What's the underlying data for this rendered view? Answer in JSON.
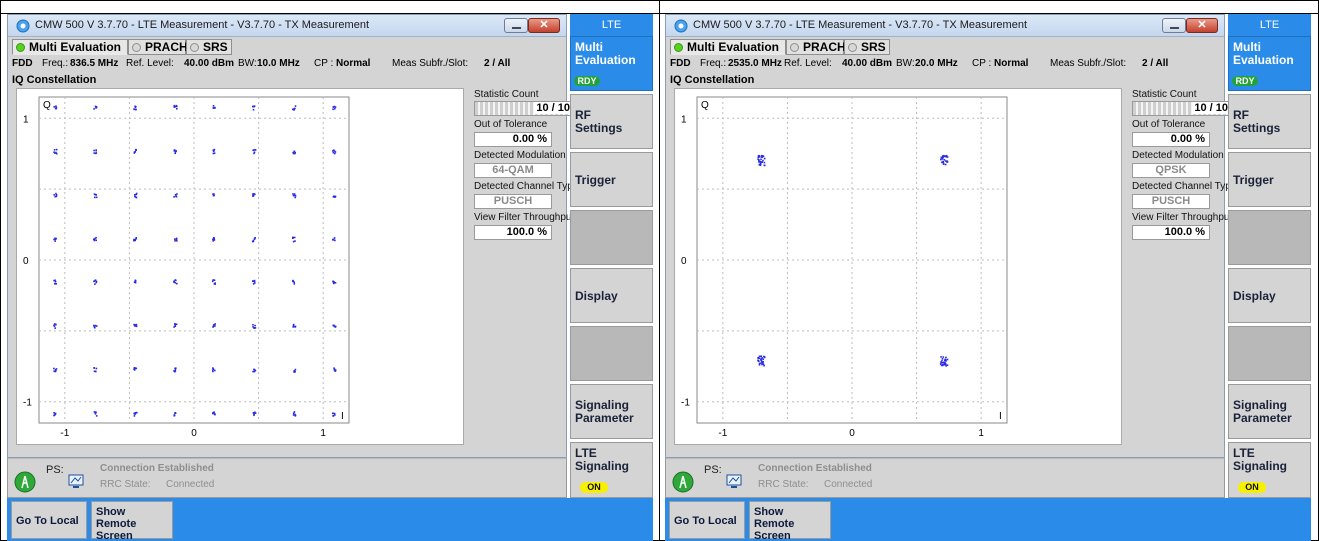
{
  "colors": {
    "accent_blue": "#2a8ce8",
    "panel_grey": "#d4d4d4",
    "ready_green": "#22a33a",
    "on_yellow": "#f7f000",
    "iq_point_blue": "#2a2ae6"
  },
  "panels": [
    {
      "window_title": "CMW 500 V 3.7.70 - LTE Measurement  - V3.7.70 - TX Measurement",
      "tabs": [
        "Multi Evaluation",
        "PRACH",
        "SRS"
      ],
      "info": {
        "mode": "FDD",
        "freq_label": "Freq.:",
        "freq_value": "836.5 MHz",
        "ref_label": "Ref. Level:",
        "ref_value": "40.00 dBm",
        "bw_label": "BW:",
        "bw_value": "10.0 MHz",
        "cp_label": "CP :",
        "cp_value": "Normal",
        "subfr_label": "Meas Subfr./Slot:",
        "subfr_value": "2  / All"
      },
      "section_title": "IQ Constellation",
      "stats": {
        "statistic_count_label": "Statistic Count",
        "statistic_count_value": "10 / 10",
        "out_of_tolerance_label": "Out of Tolerance",
        "out_of_tolerance_value": "0.00  %",
        "detected_modulation_label": "Detected Modulation",
        "detected_modulation_value": "64-QAM",
        "detected_channel_label": "Detected Channel Type",
        "detected_channel_value": "PUSCH",
        "filter_throughput_label": "View Filter Throughput",
        "filter_throughput_value": "100.0  %"
      },
      "status": {
        "ps_label": "PS:",
        "connection_text": "Connection Established",
        "rrc_label": "RRC State:",
        "rrc_value": "Connected"
      },
      "bottom_buttons": {
        "local": "Go To Local",
        "remote": "Show Remote Screen"
      },
      "sidebar": {
        "header": "LTE",
        "multi_evaluation": "Multi Evaluation",
        "rdy_badge": "RDY",
        "rf_settings": "RF Settings",
        "trigger": "Trigger",
        "display": "Display",
        "signaling_parameter": "Signaling Parameter",
        "lte_signaling": "LTE Signaling",
        "on_badge": "ON"
      }
    },
    {
      "window_title": "CMW 500 V 3.7.70 - LTE Measurement  - V3.7.70 - TX Measurement",
      "tabs": [
        "Multi Evaluation",
        "PRACH",
        "SRS"
      ],
      "info": {
        "mode": "FDD",
        "freq_label": "Freq.:",
        "freq_value": "2535.0 MHz",
        "ref_label": "Ref. Level:",
        "ref_value": "40.00 dBm",
        "bw_label": "BW:",
        "bw_value": "20.0 MHz",
        "cp_label": "CP :",
        "cp_value": "Normal",
        "subfr_label": "Meas Subfr./Slot:",
        "subfr_value": "2  / All"
      },
      "section_title": "IQ Constellation",
      "stats": {
        "statistic_count_label": "Statistic Count",
        "statistic_count_value": "10 / 10",
        "out_of_tolerance_label": "Out of Tolerance",
        "out_of_tolerance_value": "0.00  %",
        "detected_modulation_label": "Detected Modulation",
        "detected_modulation_value": "QPSK",
        "detected_channel_label": "Detected Channel Type",
        "detected_channel_value": "PUSCH",
        "filter_throughput_label": "View Filter Throughput",
        "filter_throughput_value": "100.0  %"
      },
      "status": {
        "ps_label": "PS:",
        "connection_text": "Connection Established",
        "rrc_label": "RRC State:",
        "rrc_value": "Connected"
      },
      "bottom_buttons": {
        "local": "Go To Local",
        "remote": "Show Remote Screen"
      },
      "sidebar": {
        "header": "LTE",
        "multi_evaluation": "Multi Evaluation",
        "rdy_badge": "RDY",
        "rf_settings": "RF Settings",
        "trigger": "Trigger",
        "display": "Display",
        "signaling_parameter": "Signaling Parameter",
        "lte_signaling": "LTE Signaling",
        "on_badge": "ON"
      }
    }
  ],
  "chart_data": [
    {
      "type": "scatter",
      "title": "IQ Constellation",
      "xlabel": "I",
      "ylabel": "Q",
      "xlim": [
        -1.2,
        1.2
      ],
      "ylim": [
        -1.15,
        1.15
      ],
      "x_ticks": [
        "-1",
        "0",
        "1"
      ],
      "y_ticks": [
        "1",
        "0",
        "-1"
      ],
      "grid": true,
      "modulation": "64-QAM",
      "levels": [
        -1.08,
        -0.77,
        -0.46,
        -0.15,
        0.15,
        0.46,
        0.77,
        1.08
      ]
    },
    {
      "type": "scatter",
      "title": "IQ Constellation",
      "xlabel": "I",
      "ylabel": "Q",
      "xlim": [
        -1.2,
        1.2
      ],
      "ylim": [
        -1.15,
        1.15
      ],
      "x_ticks": [
        "-1",
        "0",
        "1"
      ],
      "y_ticks": [
        "1",
        "0",
        "-1"
      ],
      "grid": true,
      "modulation": "QPSK",
      "levels": [
        -0.707,
        0.707
      ]
    }
  ]
}
